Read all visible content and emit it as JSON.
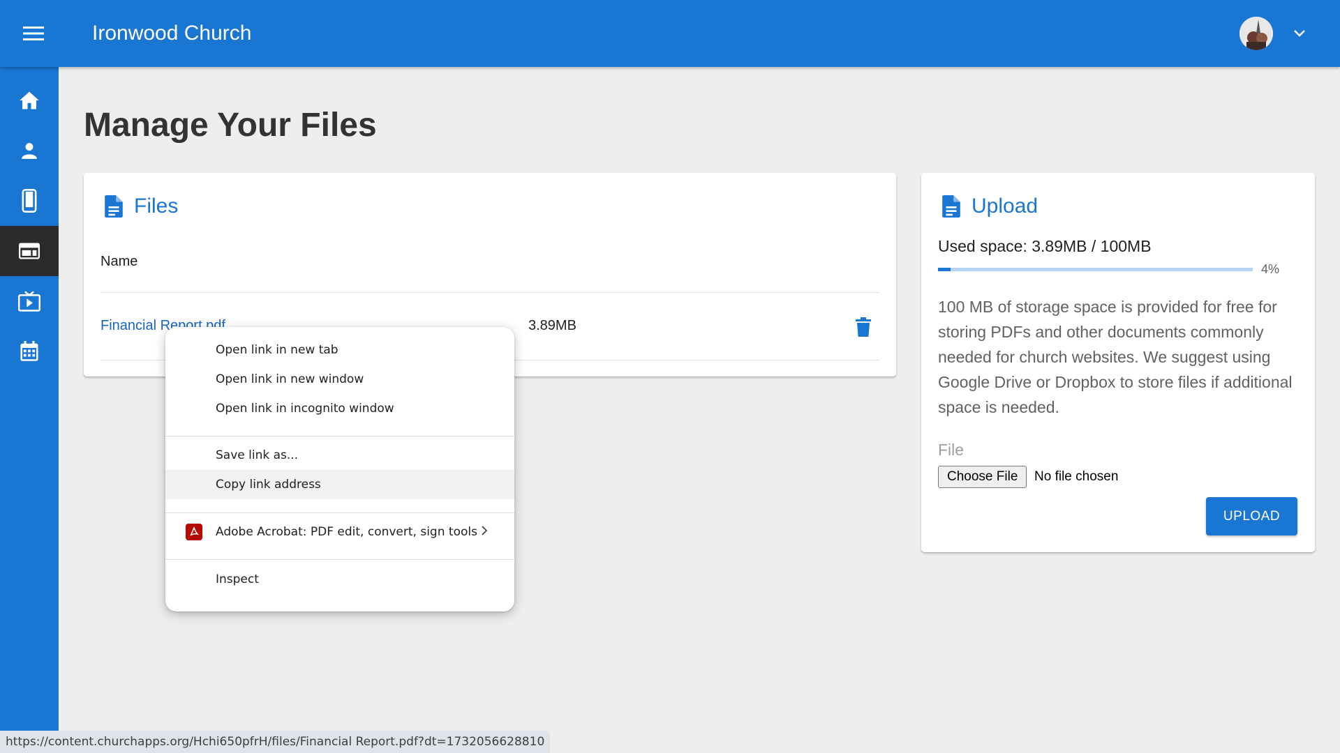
{
  "app": {
    "title": "Ironwood Church"
  },
  "header": {
    "menu_icon": "menu-icon",
    "avatar": "user-avatar",
    "chevron": "chevron-down-icon"
  },
  "sidebar": {
    "items": [
      {
        "name": "home",
        "icon": "home-icon"
      },
      {
        "name": "people",
        "icon": "person-icon"
      },
      {
        "name": "mobile",
        "icon": "mobile-icon"
      },
      {
        "name": "website",
        "icon": "web-icon",
        "active": true
      },
      {
        "name": "sermons",
        "icon": "tv-icon"
      },
      {
        "name": "calendar",
        "icon": "calendar-icon"
      }
    ]
  },
  "page": {
    "title": "Manage Your Files"
  },
  "files_card": {
    "title": "Files",
    "column_name": "Name",
    "rows": [
      {
        "name": "Financial Report.pdf",
        "size": "3.89MB"
      }
    ]
  },
  "upload_card": {
    "title": "Upload",
    "used_space": "Used space: 3.89MB / 100MB",
    "progress_percent": 4,
    "progress_label": "4%",
    "description": "100 MB of storage space is provided for free for storing PDFs and other documents commonly needed for church websites. We suggest using Google Drive or Dropbox to store files if additional space is needed.",
    "file_label": "File",
    "choose_file_label": "Choose File",
    "no_file_text": "No file chosen",
    "upload_button": "UPLOAD"
  },
  "context_menu": {
    "items": [
      "Open link in new tab",
      "Open link in new window",
      "Open link in incognito window",
      "Save link as...",
      "Copy link address",
      "Adobe Acrobat: PDF edit, convert, sign tools",
      "Inspect"
    ],
    "hovered_index": 4
  },
  "status_bar": {
    "url": "https://content.churchapps.org/Hchi650pfrH/files/Financial Report.pdf?dt=1732056628810"
  },
  "colors": {
    "primary": "#1976d2",
    "sidebar_active": "#2b2b2b",
    "acrobat_red": "#b30b00"
  }
}
